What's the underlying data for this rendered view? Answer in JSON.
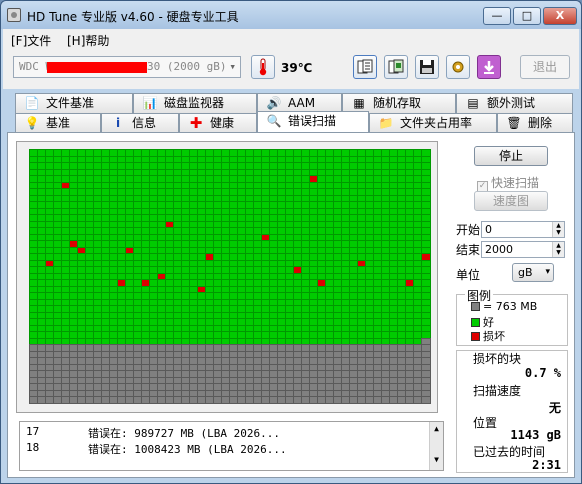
{
  "window": {
    "title": "HD Tune 专业版 v4.60 - 硬盘专业工具",
    "min_label": "—",
    "max_label": "□",
    "close_label": "X"
  },
  "menu": {
    "file": "[F]文件",
    "help": "[H]帮助"
  },
  "toolbar": {
    "drive_prefix": "WDC W",
    "drive_suffix": "30 (2000 gB)",
    "temperature": "39℃",
    "exit_label": "退出"
  },
  "tabs_row1": [
    "文件基准",
    "磁盘监视器",
    "AAM",
    "随机存取",
    "额外测试"
  ],
  "tabs_row2": [
    "基准",
    "信息",
    "健康",
    "错误扫描",
    "文件夹占用率",
    "删除"
  ],
  "active_tab": "错误扫描",
  "controls": {
    "stop_label": "停止",
    "quick_scan_label": "快速扫描",
    "quick_scan_checked": true,
    "speed_map_label": "速度图",
    "start_label": "开始",
    "start_value": "0",
    "end_label": "结束",
    "end_value": "2000",
    "unit_label": "单位",
    "unit_value": "gB"
  },
  "legend": {
    "title": "图例",
    "block_size": "= 763 MB",
    "good": "好",
    "bad": "损坏",
    "colors": {
      "unscanned": "#808080",
      "good": "#00cc00",
      "bad": "#dd0000"
    }
  },
  "stats": {
    "damaged_label": "损坏的块",
    "damaged_value": "0.7 %",
    "speed_label": "扫描速度",
    "speed_value": "无",
    "position_label": "位置",
    "position_value": "1143 gB",
    "elapsed_label": "已过去的时间",
    "elapsed_value": "2:31"
  },
  "log": [
    {
      "n": "17",
      "text": "错误在:  989727 MB (LBA 2026..."
    },
    {
      "n": "18",
      "text": "错误在:  1008423 MB (LBA 2026..."
    }
  ],
  "scan_grid": {
    "columns": 50,
    "rows": 39,
    "scanned_cells": 1499,
    "bad_cells": [
      [
        4,
        5
      ],
      [
        35,
        4
      ],
      [
        17,
        11
      ],
      [
        5,
        14
      ],
      [
        6,
        15
      ],
      [
        12,
        15
      ],
      [
        29,
        13
      ],
      [
        2,
        17
      ],
      [
        22,
        16
      ],
      [
        16,
        19
      ],
      [
        33,
        18
      ],
      [
        41,
        17
      ],
      [
        49,
        16
      ],
      [
        11,
        20
      ],
      [
        14,
        20
      ],
      [
        36,
        20
      ],
      [
        47,
        20
      ],
      [
        21,
        21
      ]
    ]
  }
}
